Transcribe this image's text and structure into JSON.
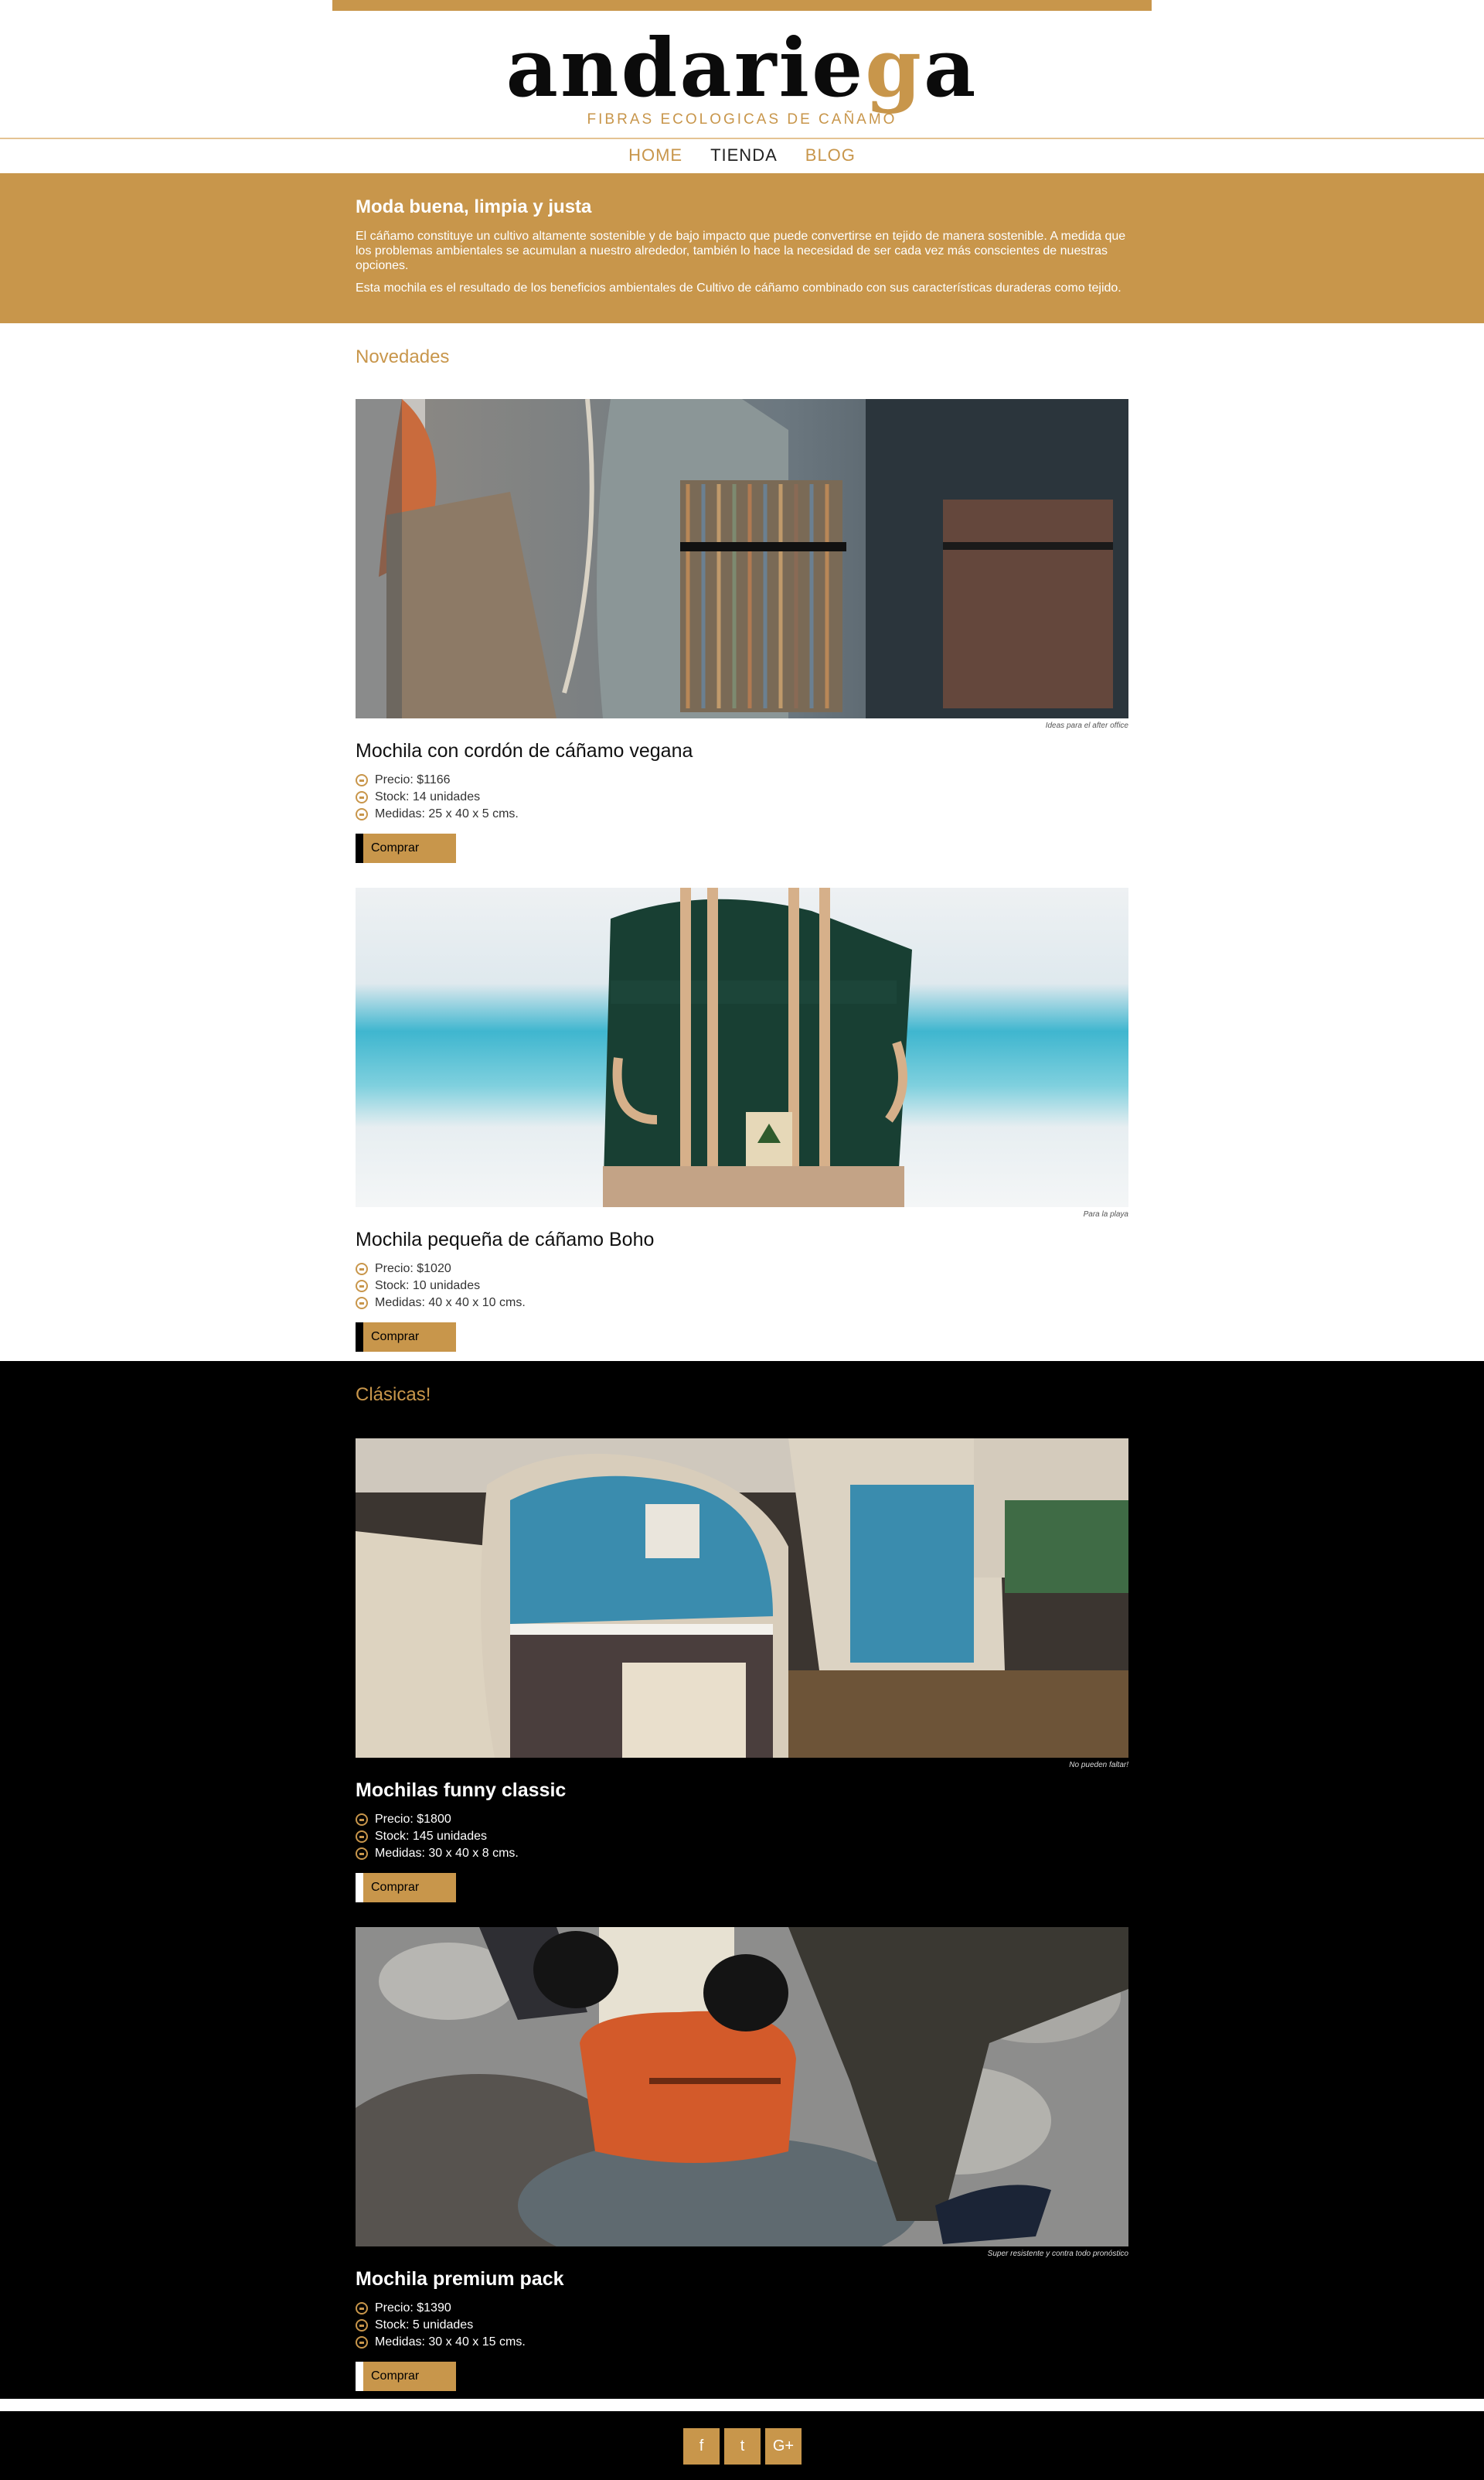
{
  "brand": {
    "logo_main": "andarie",
    "logo_accent": "g",
    "logo_end": "a",
    "tagline": "FIBRAS ECOLOGICAS DE CAÑAMO",
    "accent_color": "#c8964b"
  },
  "nav": {
    "items": [
      {
        "label": "HOME"
      },
      {
        "label": "TIENDA"
      },
      {
        "label": "BLOG"
      }
    ],
    "active": "TIENDA"
  },
  "hero": {
    "title": "Moda buena, limpia y justa",
    "paragraph_1": "El cáñamo constituye un cultivo altamente sostenible y de bajo impacto que puede convertirse en tejido de manera sostenible. A medida que los problemas ambientales se acumulan a nuestro alrededor, también lo hace la necesidad de ser cada vez más conscientes de nuestras opciones.",
    "paragraph_2": "Esta mochila es el resultado de los beneficios ambientales de Cultivo de cáñamo combinado con sus características duraderas como tejido."
  },
  "sections": {
    "novedades": {
      "title": "Novedades",
      "products": [
        {
          "caption": "Ideas para el after office",
          "name": "Mochila con cordón de cáñamo vegana",
          "price": "Precio: $1166",
          "stock": "Stock: 14 unidades",
          "size": "Medidas: 25 x 40 x 5 cms.",
          "button": "Comprar"
        },
        {
          "caption": "Para la playa",
          "name": "Mochila pequeña de cáñamo Boho",
          "price": "Precio: $1020",
          "stock": "Stock: 10 unidades",
          "size": "Medidas: 40 x 40 x 10 cms.",
          "button": "Comprar"
        }
      ]
    },
    "clasicas": {
      "title": "Clásicas!",
      "products": [
        {
          "caption": "No pueden faltar!",
          "name": "Mochilas funny classic",
          "price": "Precio: $1800",
          "stock": "Stock: 145 unidades",
          "size": "Medidas: 30 x 40 x 8 cms.",
          "button": "Comprar"
        },
        {
          "caption": "Super resistente y contra todo pronóstico",
          "name": "Mochila premium pack",
          "price": "Precio: $1390",
          "stock": "Stock: 5 unidades",
          "size": "Medidas: 30 x 40 x 15 cms.",
          "button": "Comprar"
        }
      ]
    }
  },
  "footer": {
    "socials": [
      {
        "icon": "facebook-icon",
        "glyph": "f"
      },
      {
        "icon": "twitter-icon",
        "glyph": "t"
      },
      {
        "icon": "google-plus-icon",
        "glyph": "G+"
      }
    ]
  }
}
